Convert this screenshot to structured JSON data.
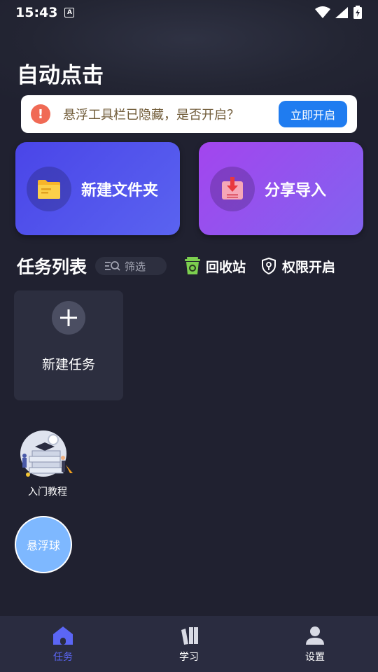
{
  "status_bar": {
    "time": "15:43",
    "a_badge": "A"
  },
  "header": {
    "title": "自动点击"
  },
  "banner": {
    "message": "悬浮工具栏已隐藏，是否开启？",
    "button_label": "立即开启",
    "warn_glyph": "!"
  },
  "cards": {
    "new_folder": {
      "label": "新建文件夹",
      "icon": "folder-icon"
    },
    "share_import": {
      "label": "分享导入",
      "icon": "download-box-icon"
    }
  },
  "task_section": {
    "title": "任务列表",
    "filter_label": "筛选",
    "recycle_label": "回收站",
    "permission_label": "权限开启"
  },
  "new_task": {
    "label": "新建任务"
  },
  "tutorial": {
    "label": "入门教程"
  },
  "float_ball": {
    "label": "悬浮球"
  },
  "bottom_nav": {
    "items": [
      {
        "label": "任务",
        "icon": "home-icon",
        "active": true
      },
      {
        "label": "学习",
        "icon": "books-icon",
        "active": false
      },
      {
        "label": "设置",
        "icon": "person-icon",
        "active": false
      }
    ]
  },
  "colors": {
    "background": "#202130",
    "banner_button": "#1f7cf0",
    "nav_active": "#5b66f5",
    "float_ball": "#7eb8ff"
  }
}
